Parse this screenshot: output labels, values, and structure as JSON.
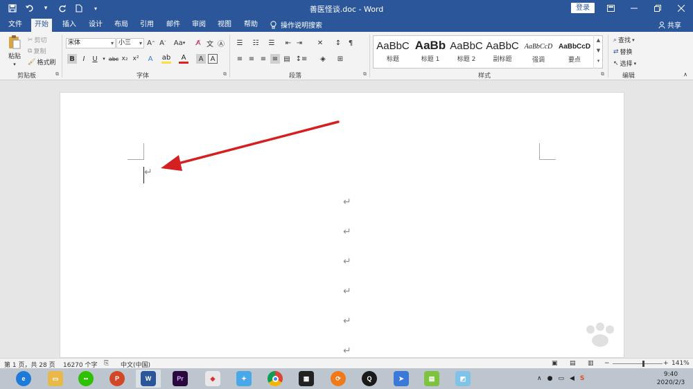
{
  "titlebar": {
    "doc_title": "善医怪谈.doc - Word",
    "login_label": "登录",
    "qat": [
      "save-icon",
      "undo-icon",
      "redo-icon",
      "new-doc-icon",
      "customize-icon"
    ]
  },
  "tabs": [
    {
      "label": "文件"
    },
    {
      "label": "开始"
    },
    {
      "label": "插入"
    },
    {
      "label": "设计"
    },
    {
      "label": "布局"
    },
    {
      "label": "引用"
    },
    {
      "label": "邮件"
    },
    {
      "label": "审阅"
    },
    {
      "label": "视图"
    },
    {
      "label": "帮助"
    }
  ],
  "tell_me": "操作说明搜索",
  "share_label": "共享",
  "clipboard": {
    "paste": "粘贴",
    "cut": "剪切",
    "copy": "复制",
    "format_painter": "格式刷",
    "group": "剪贴板"
  },
  "font": {
    "name": "宋体",
    "size": "小三",
    "group": "字体",
    "change_case": "Aa"
  },
  "paragraph": {
    "group": "段落"
  },
  "styles": {
    "group": "样式",
    "items": [
      {
        "sample": "AaBbC",
        "name": "标题"
      },
      {
        "sample": "AaBb",
        "name": "标题 1"
      },
      {
        "sample": "AaBbC",
        "name": "标题 2"
      },
      {
        "sample": "AaBbC",
        "name": "副标题"
      },
      {
        "sample": "AaBbCcD",
        "name": "强调"
      },
      {
        "sample": "AaBbCcD",
        "name": "要点"
      }
    ]
  },
  "editing": {
    "find": "查找",
    "replace": "替换",
    "select": "选择",
    "group": "编辑"
  },
  "status": {
    "page": "第 1 页，共 28 页",
    "words": "16270 个字",
    "language": "中文(中国)",
    "zoom": "141%"
  },
  "taskbar": {
    "time": "9:40",
    "date": "2020/2/3",
    "apps": [
      "browser-icon",
      "file-explorer-icon",
      "wechat-icon",
      "powerpoint-icon",
      "word-icon",
      "premiere-icon",
      "app-icon",
      "bird-app-icon",
      "chrome-icon",
      "video-editor-icon",
      "app-icon-2",
      "qq-icon",
      "app-icon-3",
      "notepad-icon",
      "app-icon-4"
    ]
  },
  "colors": {
    "brand": "#2b579a",
    "arrow": "#d42020"
  }
}
